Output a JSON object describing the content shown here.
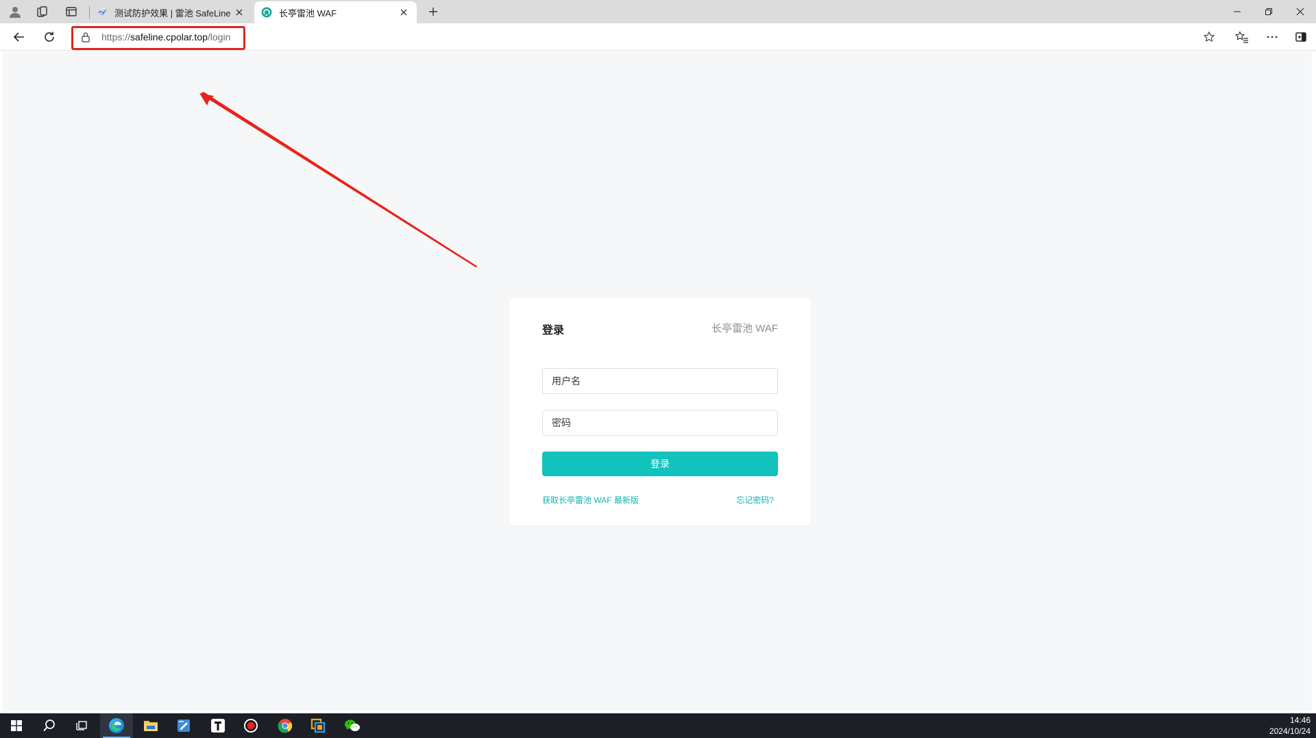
{
  "browser": {
    "tabs": [
      {
        "title": "测试防护效果 | 雷池 SafeLine",
        "active": false
      },
      {
        "title": "长亭雷池 WAF",
        "active": true
      }
    ],
    "address": {
      "scheme": "https://",
      "host": "safeline.cpolar.top",
      "path": "/login"
    }
  },
  "login": {
    "title": "登录",
    "brand": "长亭雷池 WAF",
    "username_placeholder": "用户名",
    "password_placeholder": "密码",
    "submit_label": "登录",
    "get_latest_link": "获取长亭雷池 WAF 最新版",
    "forgot_link": "忘记密码?"
  },
  "annotations": {
    "highlight_color": "#e0251c"
  },
  "theme": {
    "accent": "#12c2bd",
    "page_background": "#f6f7f9"
  },
  "taskbar": {
    "apps": [
      "windows-start",
      "search",
      "task-view",
      "edge",
      "file-explorer",
      "notepad",
      "typora",
      "screen-recorder",
      "chrome",
      "virtual-machine",
      "wechat"
    ],
    "time": "14:46",
    "date": "2024/10/24"
  }
}
